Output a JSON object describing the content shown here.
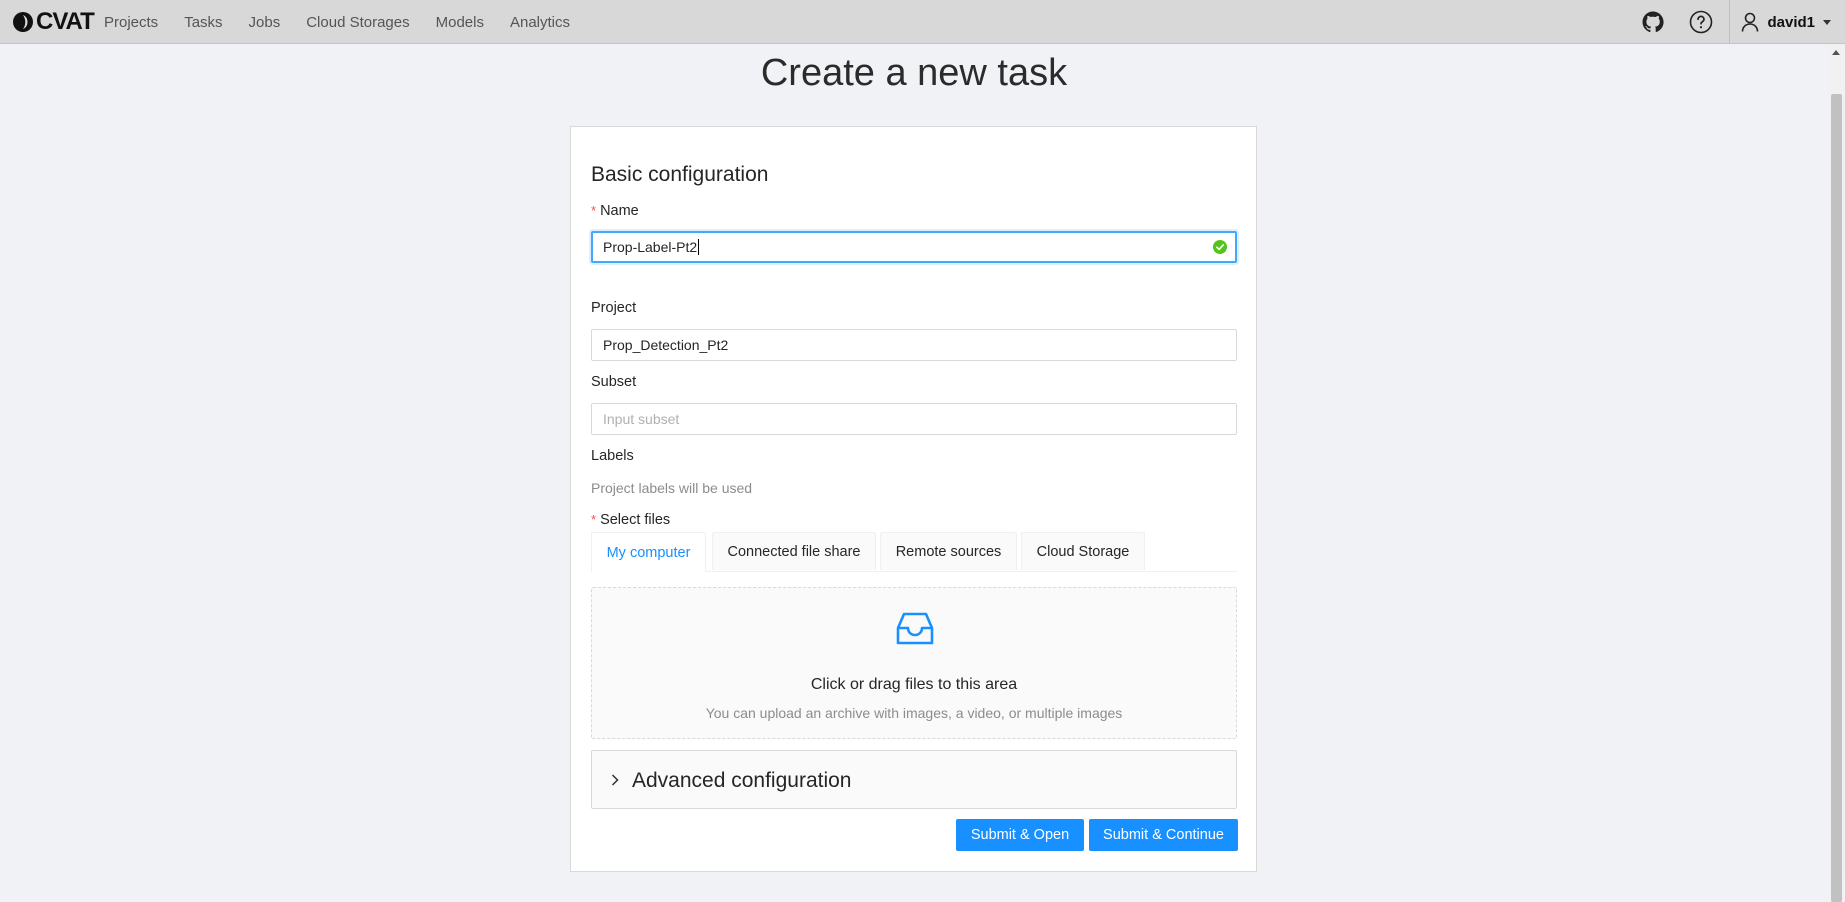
{
  "header": {
    "logo_text": "CVAT",
    "nav": [
      "Projects",
      "Tasks",
      "Jobs",
      "Cloud Storages",
      "Models",
      "Analytics"
    ],
    "github_icon": "github-icon",
    "help_icon": "question-circle-icon",
    "user": {
      "name": "david1",
      "icon": "user-icon"
    }
  },
  "page": {
    "title": "Create a new task"
  },
  "form": {
    "section_title": "Basic configuration",
    "name": {
      "label": "Name",
      "value": "Prop-Label-Pt2"
    },
    "project": {
      "label": "Project",
      "value": "Prop_Detection_Pt2"
    },
    "subset": {
      "label": "Subset",
      "placeholder": "Input subset"
    },
    "labels": {
      "label": "Labels",
      "hint": "Project labels will be used"
    },
    "files": {
      "label": "Select files",
      "tabs": [
        "My computer",
        "Connected file share",
        "Remote sources",
        "Cloud Storage"
      ],
      "active_tab": "My computer",
      "dropzone": {
        "title": "Click or drag files to this area",
        "hint": "You can upload an archive with images, a video, or multiple images",
        "icon": "inbox-icon"
      }
    },
    "advanced": {
      "title": "Advanced configuration"
    },
    "buttons": {
      "submit_open": "Submit & Open",
      "submit_continue": "Submit & Continue"
    }
  },
  "colors": {
    "primary": "#1890ff",
    "success": "#52c41a",
    "required": "#ff4d4f",
    "header_bg": "#d8d8d8",
    "page_bg": "#f1f2f5"
  }
}
